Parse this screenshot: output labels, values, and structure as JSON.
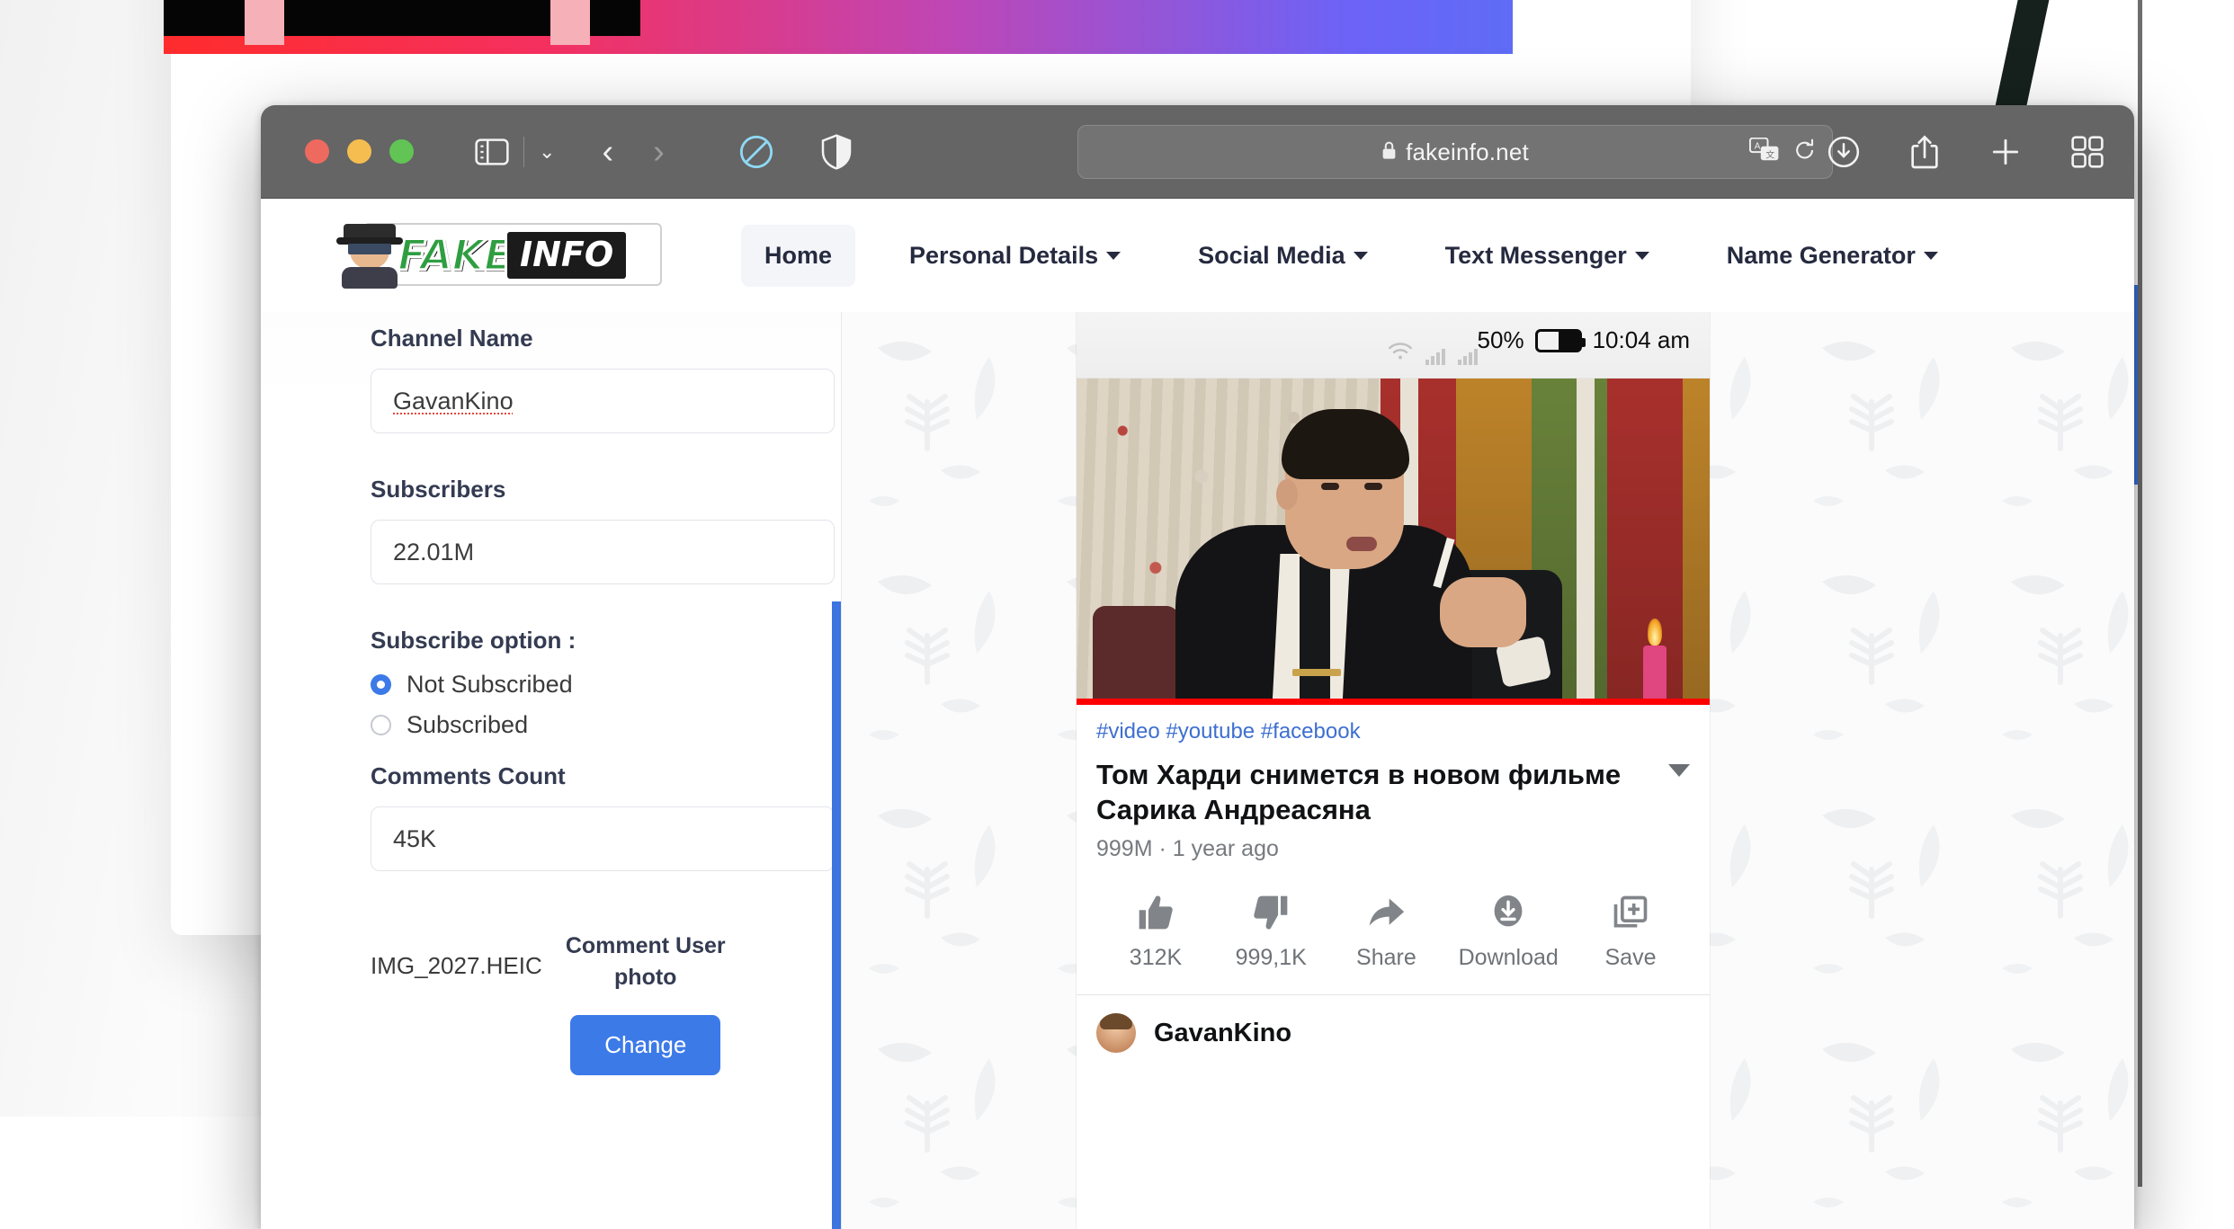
{
  "browser": {
    "url": "fakeinfo.net",
    "lock_icon": "lock-icon",
    "translate_icon": "translate-icon",
    "reload_icon": "reload-icon",
    "sidebar_icon": "sidebar-toggle-icon",
    "tab_group_caret_icon": "chevron-down-icon",
    "back_icon": "chevron-left-icon",
    "forward_icon": "chevron-right-icon",
    "block_icon": "no-entry-icon",
    "shield_icon": "privacy-shield-icon",
    "downloads_icon": "download-circle-icon",
    "share_icon": "share-icon",
    "new_tab_icon": "plus-icon",
    "tab_overview_icon": "grid-icon"
  },
  "site": {
    "logo": {
      "avatar_icon": "spy-avatar-icon",
      "word_one": "FAKE",
      "word_two": "INFO"
    },
    "nav": [
      {
        "label": "Home",
        "has_caret": false,
        "active": true
      },
      {
        "label": "Personal Details",
        "has_caret": true,
        "active": false
      },
      {
        "label": "Social Media",
        "has_caret": true,
        "active": false
      },
      {
        "label": "Text Messenger",
        "has_caret": true,
        "active": false
      },
      {
        "label": "Name Generator",
        "has_caret": true,
        "active": false
      }
    ]
  },
  "form": {
    "channel_name": {
      "label": "Channel Name",
      "value": "GavanKino"
    },
    "subscribers": {
      "label": "Subscribers",
      "value": "22.01M"
    },
    "subscribe_option": {
      "label": "Subscribe option :",
      "options": [
        {
          "label": "Not Subscribed",
          "selected": true
        },
        {
          "label": "Subscribed",
          "selected": false
        }
      ]
    },
    "comments_count": {
      "label": "Comments Count",
      "value": "45K"
    },
    "comment_user_photo": {
      "file_name": "IMG_2027.HEIC",
      "caption": "Comment User photo",
      "button_label": "Change"
    }
  },
  "preview": {
    "statusbar": {
      "wifi_icon": "wifi-icon",
      "signal_icon": "cellular-signal-icon",
      "battery_percent": "50%",
      "battery_icon": "battery-icon",
      "time": "10:04 am"
    },
    "video": {
      "tags": "#video #youtube #facebook",
      "title": "Том Харди снимется в новом фильме Сарика Андреасяна",
      "views_and_age": "999M · 1 year ago",
      "menu_icon": "chevron-down-icon"
    },
    "actions": [
      {
        "icon": "thumbs-up-icon",
        "label": "312K"
      },
      {
        "icon": "thumbs-down-icon",
        "label": "999,1K"
      },
      {
        "icon": "share-arrow-icon",
        "label": "Share"
      },
      {
        "icon": "download-icon",
        "label": "Download"
      },
      {
        "icon": "save-icon",
        "label": "Save"
      }
    ],
    "channel": {
      "avatar_icon": "channel-avatar",
      "name": "GavanKino"
    }
  },
  "colors": {
    "accent_blue": "#3c7ae8",
    "scrollbar_blue": "#3c74e0",
    "logo_green": "#2f9e41",
    "progress_red": "#ff0000",
    "link_blue": "#3e6fd0"
  }
}
